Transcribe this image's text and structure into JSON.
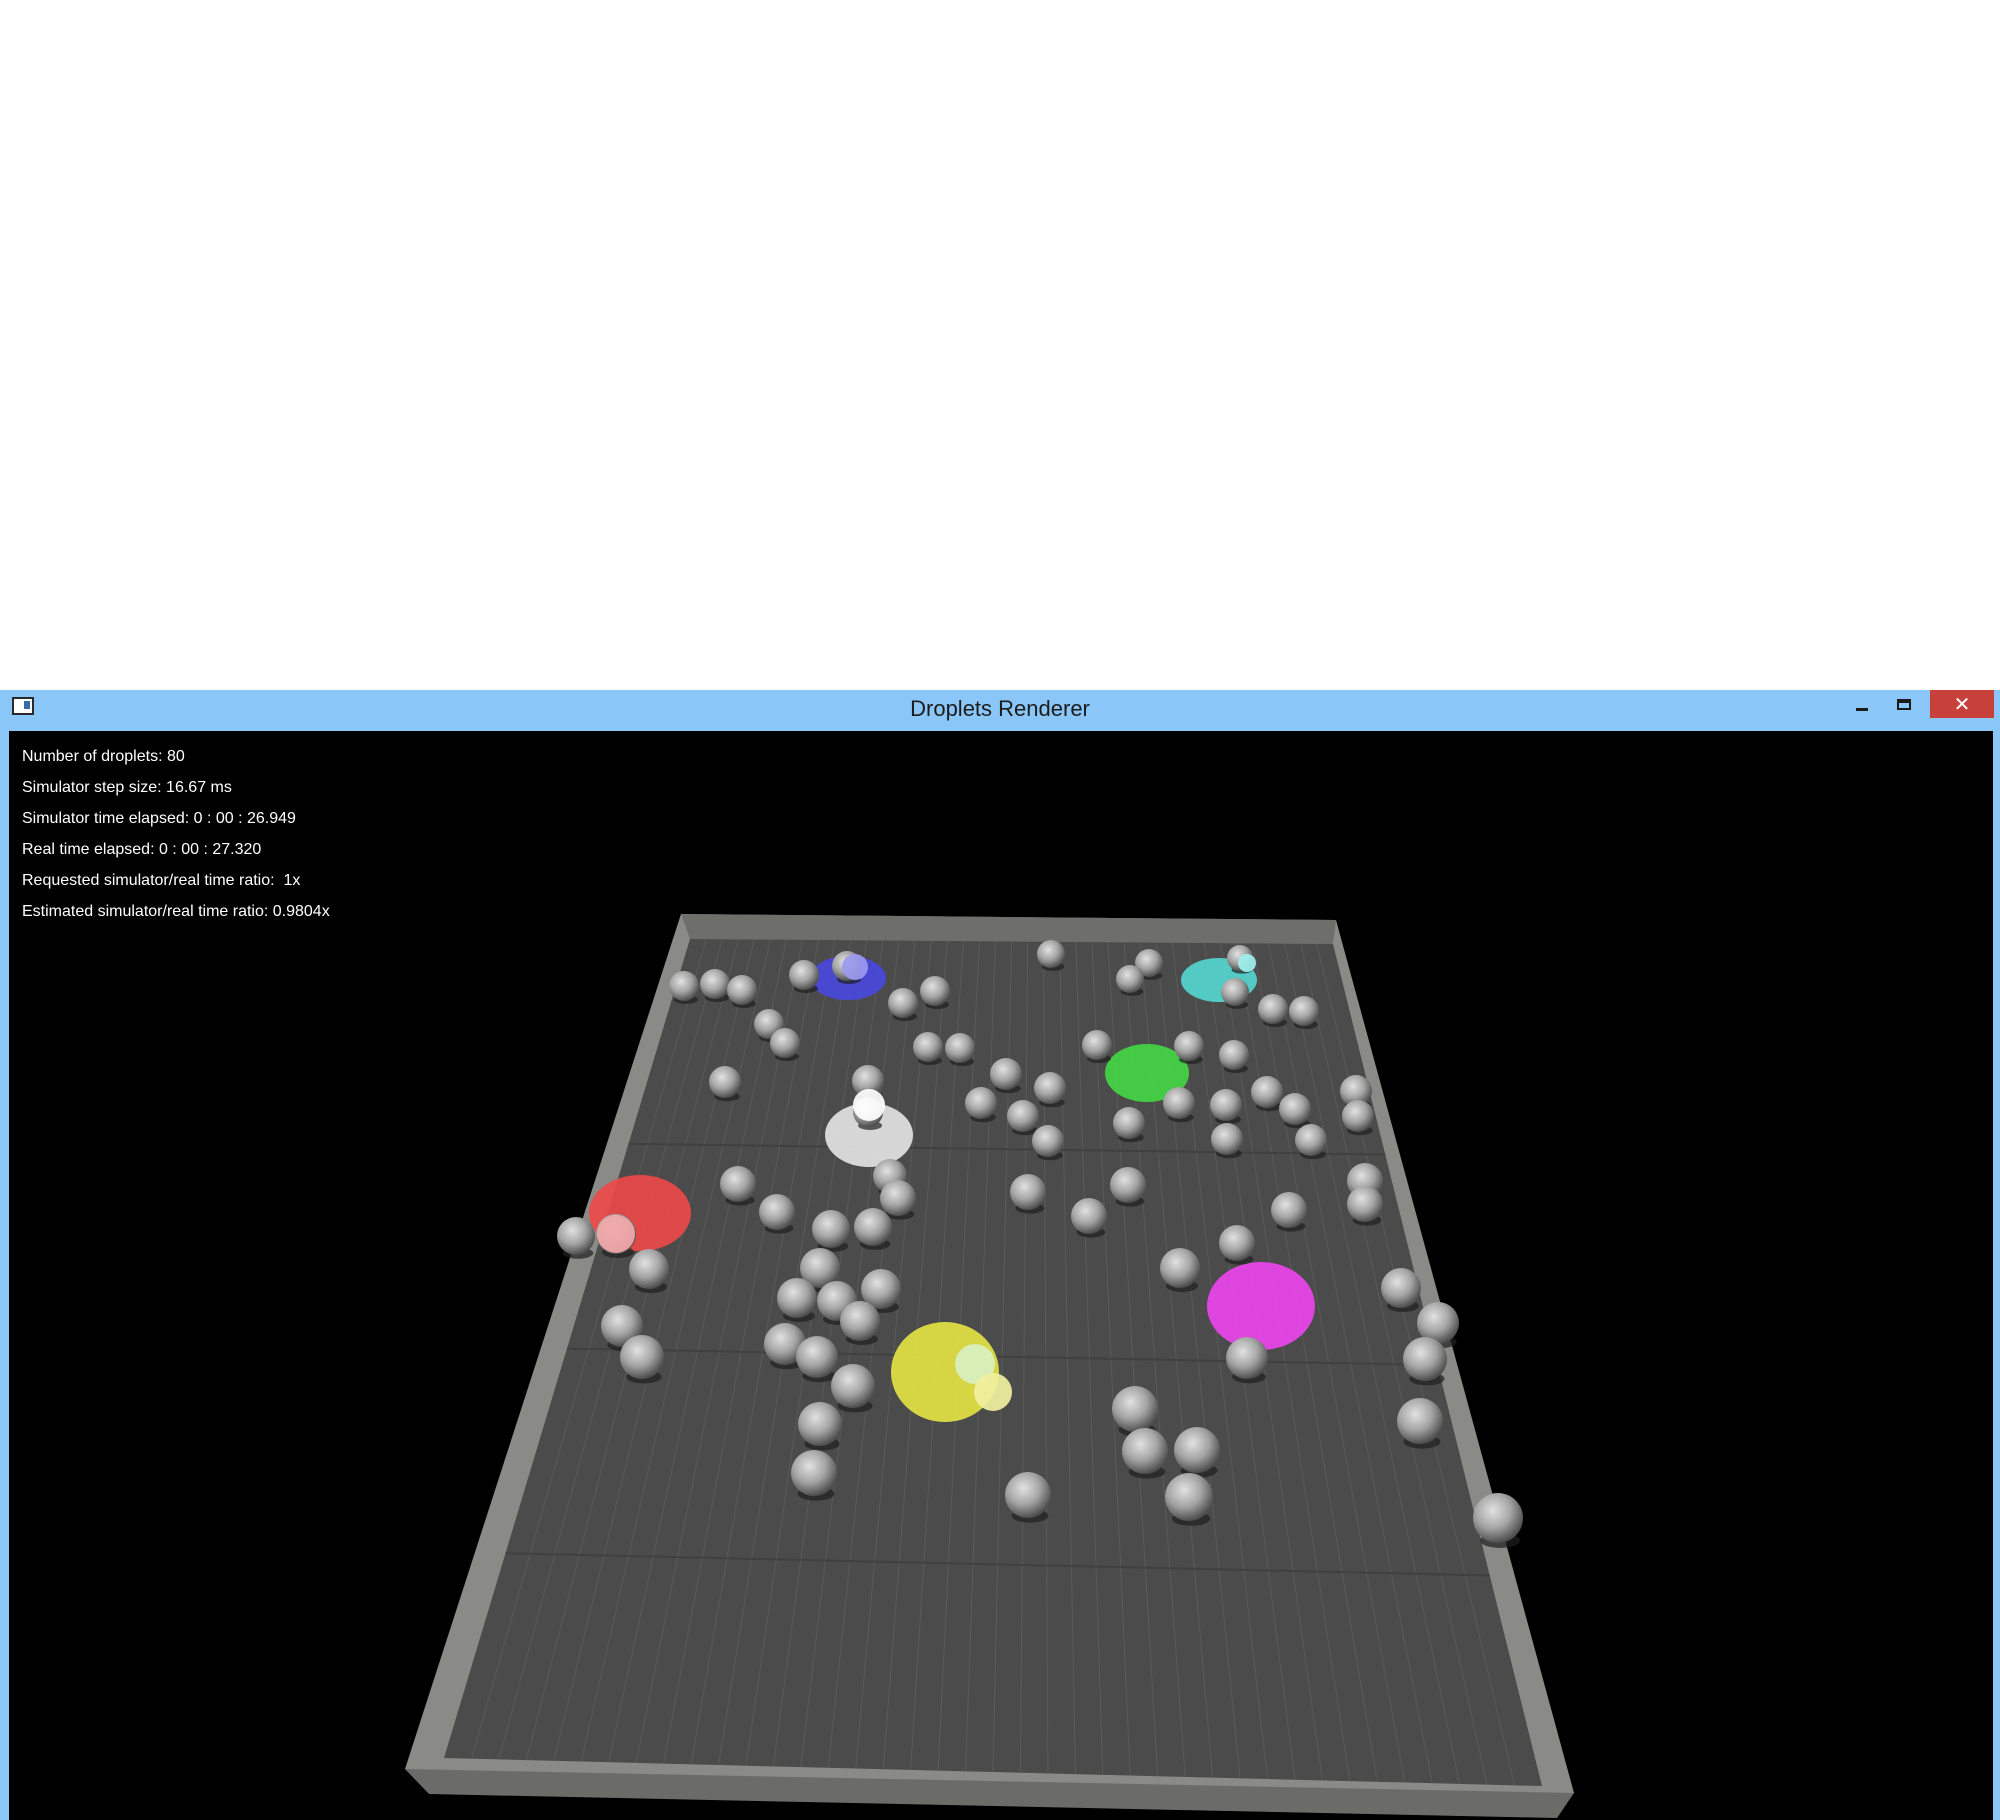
{
  "window": {
    "title": "Droplets Renderer",
    "close_glyph": "✕",
    "icons": {
      "app": "app-window-icon",
      "minimize": "minimize-icon",
      "maximize": "maximize-icon",
      "close": "close-icon"
    },
    "colors": {
      "titlebar": "#8ac6f8",
      "close": "#c7403a",
      "viewport": "#000000"
    }
  },
  "stats": {
    "droplets": "Number of droplets: 80",
    "step_size": "Simulator step size: 16.67 ms",
    "sim_time": "Simulator time elapsed: 0 : 00 : 26.949",
    "real_time": "Real time elapsed: 0 : 00 : 27.320",
    "requested_ratio": "Requested simulator/real time ratio:  1x",
    "estimated_ratio": "Estimated simulator/real time ratio: 0.9804x"
  },
  "scene": {
    "arena_floor_color": "#4b4b4b",
    "arena_wall_color": "#8c8c88",
    "light_colors": [
      "#4848e0",
      "#55d8d2",
      "#44d844",
      "#e6e6e6",
      "#ee4848",
      "#ee44ee",
      "#e6e644"
    ],
    "droplet_color": "#a6a6a6",
    "droplet_count_shown": 80
  }
}
